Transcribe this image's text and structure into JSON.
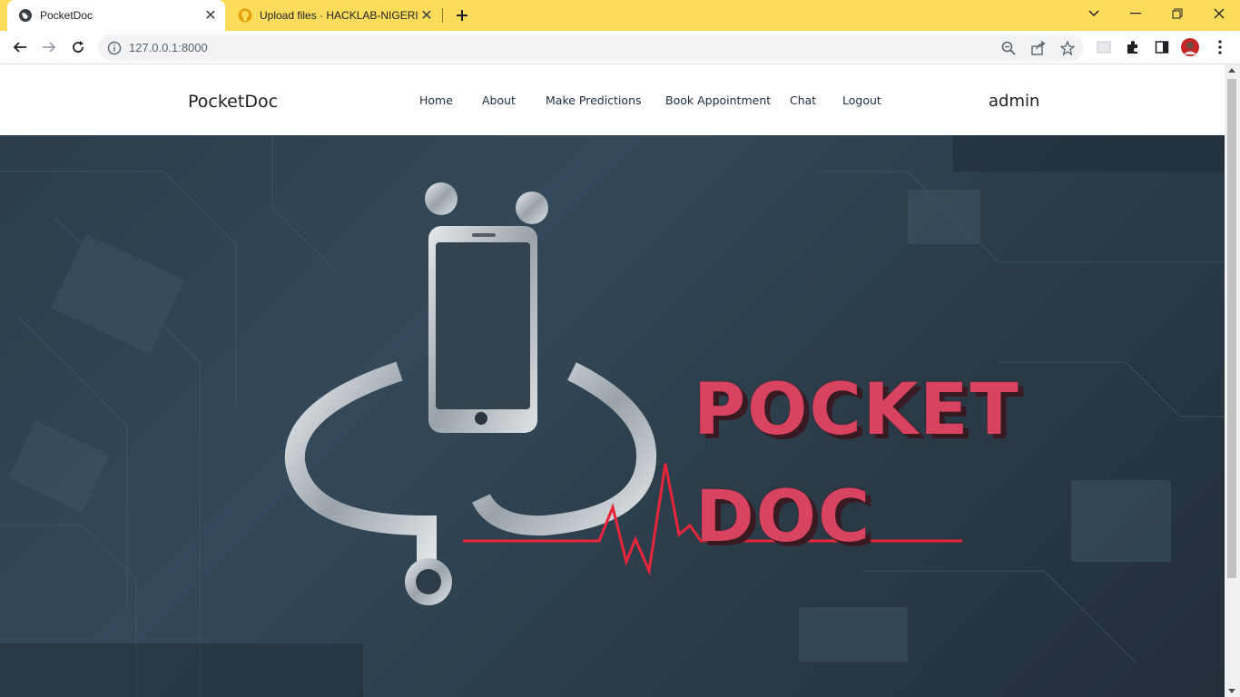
{
  "browser": {
    "tabs": [
      {
        "title": "PocketDoc",
        "active": true,
        "icon": "globe-icon"
      },
      {
        "title": "Upload files · HACKLAB-NIGERIA",
        "active": false,
        "icon": "github-icon"
      }
    ],
    "address": "127.0.0.1:8000",
    "accent": "#fddc5c"
  },
  "site": {
    "brand": "PocketDoc",
    "nav": [
      {
        "label": "Home"
      },
      {
        "label": "About"
      },
      {
        "label": "Make Predictions"
      },
      {
        "label": "Book Appointment"
      },
      {
        "label": "Chat"
      },
      {
        "label": "Logout"
      }
    ],
    "user": "admin"
  },
  "hero": {
    "logo_line1": "POCKET",
    "logo_line2": "DOC",
    "logo_color": "#d8435f"
  }
}
